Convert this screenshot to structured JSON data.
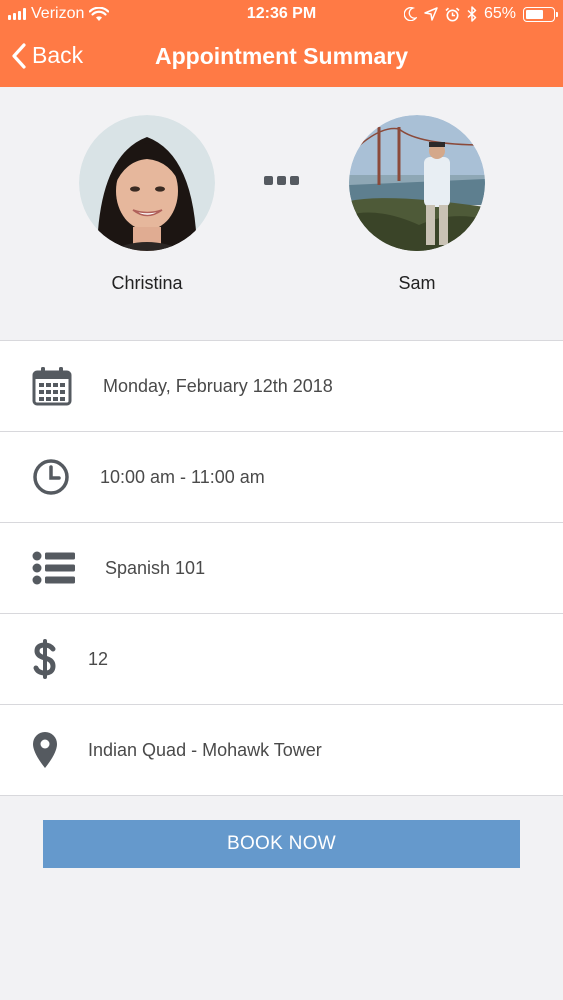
{
  "status": {
    "carrier": "Verizon",
    "time": "12:36 PM",
    "battery": "65%",
    "battery_level": 0.65
  },
  "nav": {
    "back_label": "Back",
    "title": "Appointment Summary"
  },
  "people": {
    "left_name": "Christina",
    "right_name": "Sam"
  },
  "details": {
    "date": "Monday, February 12th 2018",
    "time": "10:00 am - 11:00 am",
    "subject": "Spanish 101",
    "price": "12",
    "location": "Indian Quad - Mohawk Tower"
  },
  "actions": {
    "book_label": "BOOK NOW"
  },
  "colors": {
    "header": "#ff7a45",
    "button": "#6599cc",
    "icon": "#555a60"
  }
}
